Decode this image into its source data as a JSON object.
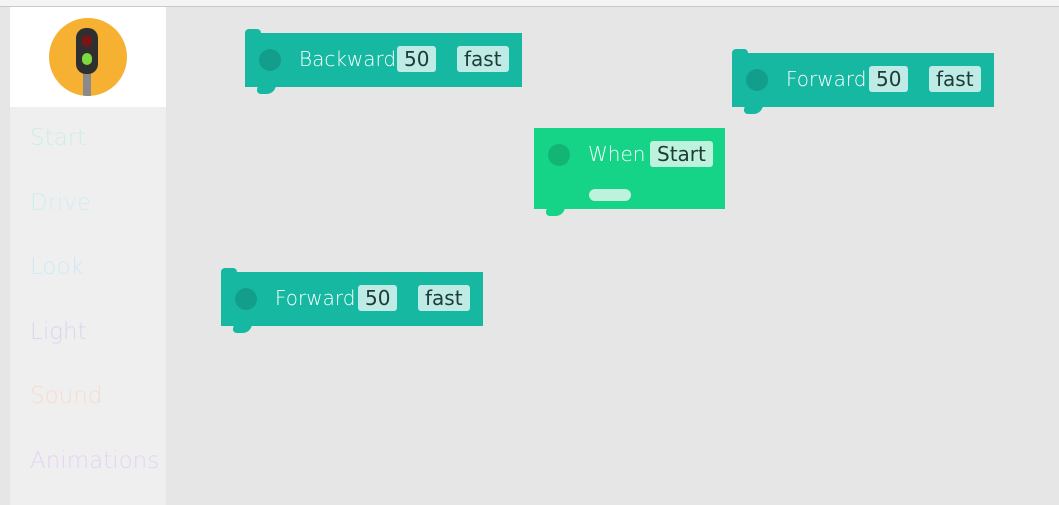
{
  "sidebar": {
    "categories": [
      {
        "label": "Start",
        "color": "#c8efe6"
      },
      {
        "label": "Drive",
        "color": "#cfeef2"
      },
      {
        "label": "Look",
        "color": "#cfe9f4"
      },
      {
        "label": "Light",
        "color": "#d7d6f1"
      },
      {
        "label": "Sound",
        "color": "#f6dccb"
      },
      {
        "label": "Animations",
        "color": "#e4d3f6"
      }
    ]
  },
  "canvas": {
    "blocks": [
      {
        "label": "Backward",
        "value": "50",
        "speed": "fast",
        "color": "#16b8a2"
      },
      {
        "label": "Forward",
        "value": "50",
        "speed": "fast",
        "color": "#16b8a2"
      },
      {
        "label": "When",
        "trigger": "Start",
        "color": "#15d387"
      },
      {
        "label": "Forward",
        "value": "50",
        "speed": "fast",
        "color": "#16b8a2"
      }
    ]
  }
}
